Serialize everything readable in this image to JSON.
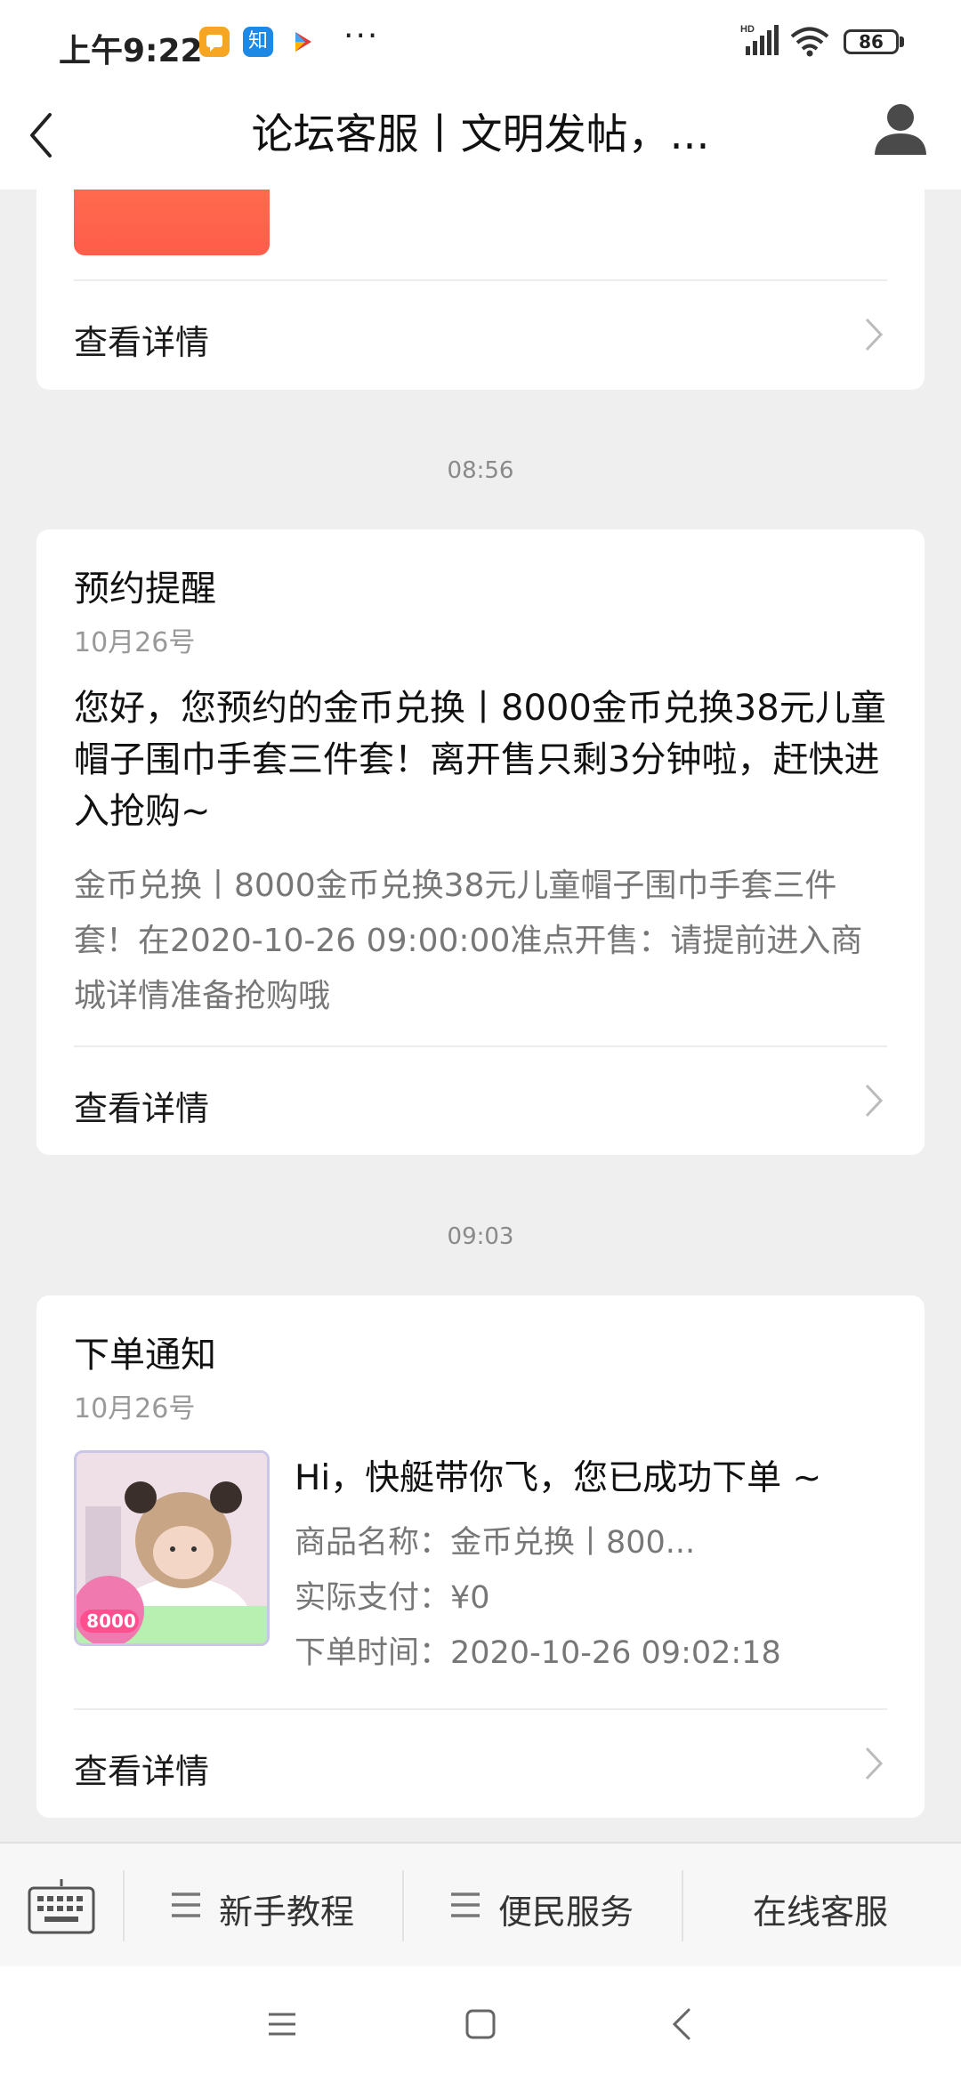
{
  "status_bar": {
    "time": "上午9:22",
    "app_icons": [
      "chat-bubble-app-icon",
      "zhihu-app-icon",
      "play-store-app-icon"
    ],
    "zhihu_label": "知",
    "overflow": "···",
    "signal_label": "HD",
    "battery": "86"
  },
  "header": {
    "title": "论坛客服丨文明发帖，..."
  },
  "cards": [
    {
      "link_label": "查看详情"
    },
    {
      "timestamp": "08:56",
      "title": "预约提醒",
      "date": "10月26号",
      "body": "您好，您预约的金币兑换丨8000金币兑换38元儿童帽子围巾手套三件套！离开售只剩3分钟啦，赶快进入抢购~",
      "sub": "金币兑换丨8000金币兑换38元儿童帽子围巾手套三件套！在2020-10-26 09:00:00准点开售：请提前进入商城详情准备抢购哦",
      "link_label": "查看详情"
    },
    {
      "timestamp": "09:03",
      "title": "下单通知",
      "date": "10月26号",
      "greeting": "Hi，快艇带你飞，您已成功下单 ~",
      "product_name": "商品名称：金币兑换丨800...",
      "paid": "实际支付：¥0",
      "order_time": "下单时间：2020-10-26 09:02:18",
      "thumb_badge": "8000",
      "link_label": "查看详情"
    }
  ],
  "bottom_bar": {
    "keyboard_icon": "keyboard-icon",
    "items": [
      {
        "label": "新手教程",
        "icon": "menu-icon"
      },
      {
        "label": "便民服务",
        "icon": "menu-icon"
      },
      {
        "label": "在线客服"
      }
    ]
  },
  "system_nav": [
    "menu-icon",
    "home-icon",
    "back-icon"
  ],
  "colors": {
    "background": "#efefef",
    "card": "#ffffff",
    "red_accent": "#ff5d4a"
  }
}
